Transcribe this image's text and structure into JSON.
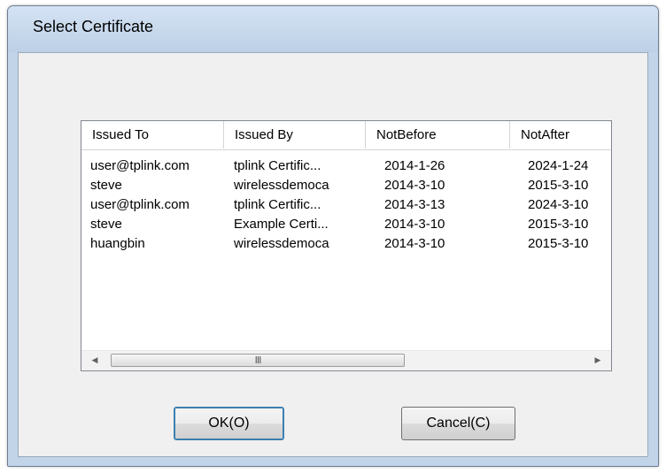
{
  "dialog": {
    "title": "Select Certificate"
  },
  "list": {
    "columns": [
      "Issued To",
      "Issued By",
      "NotBefore",
      "NotAfter"
    ],
    "rows": [
      [
        "user@tplink.com",
        "tplink Certific...",
        "2014-1-26",
        "2024-1-24"
      ],
      [
        "steve",
        "wirelessdemoca",
        "2014-3-10",
        "2015-3-10"
      ],
      [
        "user@tplink.com",
        "tplink Certific...",
        "2014-3-13",
        "2024-3-10"
      ],
      [
        "steve",
        "Example Certi...",
        "2014-3-10",
        "2015-3-10"
      ],
      [
        "huangbin",
        "wirelessdemoca",
        "2014-3-10",
        "2015-3-10"
      ]
    ],
    "scrollbar": {
      "grip": "III",
      "left_icon": "scroll-left-arrow-icon",
      "right_icon": "scroll-right-arrow-icon"
    }
  },
  "buttons": {
    "ok_label": "OK(O)",
    "cancel_label": "Cancel(C)"
  },
  "colors": {
    "title_bar": "#c2d4e8",
    "client_bg": "#f0f0f0",
    "list_bg": "#ffffff"
  }
}
